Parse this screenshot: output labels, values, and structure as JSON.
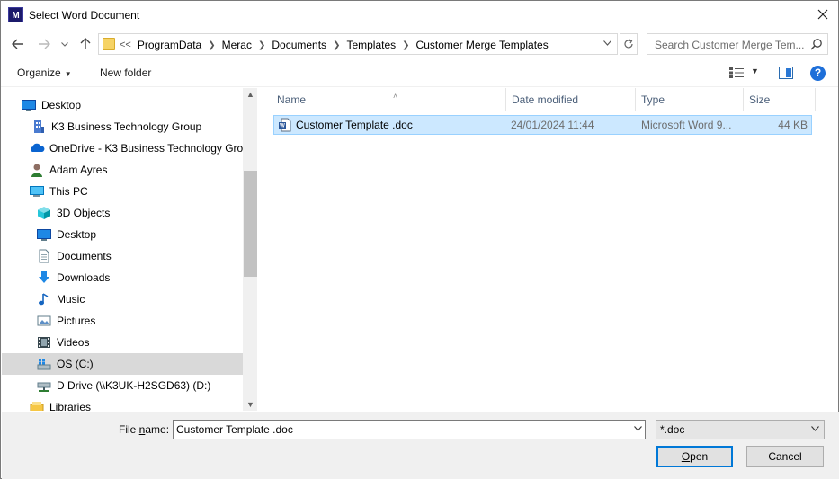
{
  "window": {
    "title": "Select Word Document",
    "logo_text": "M"
  },
  "address": {
    "more_glyph": "<<",
    "crumbs": [
      "ProgramData",
      "Merac",
      "Documents",
      "Templates",
      "Customer Merge Templates"
    ]
  },
  "search": {
    "placeholder": "Search Customer Merge Tem..."
  },
  "toolbar": {
    "organize_label": "Organize",
    "new_folder_label": "New folder",
    "help_label": "?"
  },
  "nav": {
    "items": [
      {
        "label": "Desktop",
        "icon": "desktop-icon"
      },
      {
        "label": "K3 Business Technology Group",
        "icon": "building-icon"
      },
      {
        "label": "OneDrive - K3 Business Technology Grou",
        "icon": "cloud-icon"
      },
      {
        "label": "Adam Ayres",
        "icon": "user-icon"
      },
      {
        "label": "This PC",
        "icon": "computer-icon"
      },
      {
        "label": "3D Objects",
        "icon": "cube-icon"
      },
      {
        "label": "Desktop",
        "icon": "desktop-icon"
      },
      {
        "label": "Documents",
        "icon": "document-icon"
      },
      {
        "label": "Downloads",
        "icon": "download-icon"
      },
      {
        "label": "Music",
        "icon": "music-icon"
      },
      {
        "label": "Pictures",
        "icon": "picture-icon"
      },
      {
        "label": "Videos",
        "icon": "video-icon"
      },
      {
        "label": "OS (C:)",
        "icon": "drive-icon",
        "selected": true
      },
      {
        "label": "D Drive (\\\\K3UK-H2SGD63) (D:)",
        "icon": "network-drive-icon"
      },
      {
        "label": "Libraries",
        "icon": "library-icon"
      }
    ]
  },
  "columns": {
    "name": "Name",
    "date_modified": "Date modified",
    "type": "Type",
    "size": "Size"
  },
  "files": [
    {
      "name": "Customer Template .doc",
      "date_modified": "24/01/2024 11:44",
      "type": "Microsoft Word 9...",
      "size": "44 KB",
      "icon": "word-document-icon"
    }
  ],
  "footer": {
    "file_name_label_pre": "File ",
    "file_name_label_u": "n",
    "file_name_label_post": "ame:",
    "file_name_value": "Customer Template .doc",
    "filter_value": "*.doc",
    "open_label_u": "O",
    "open_label_rest": "pen",
    "cancel_label": "Cancel"
  }
}
